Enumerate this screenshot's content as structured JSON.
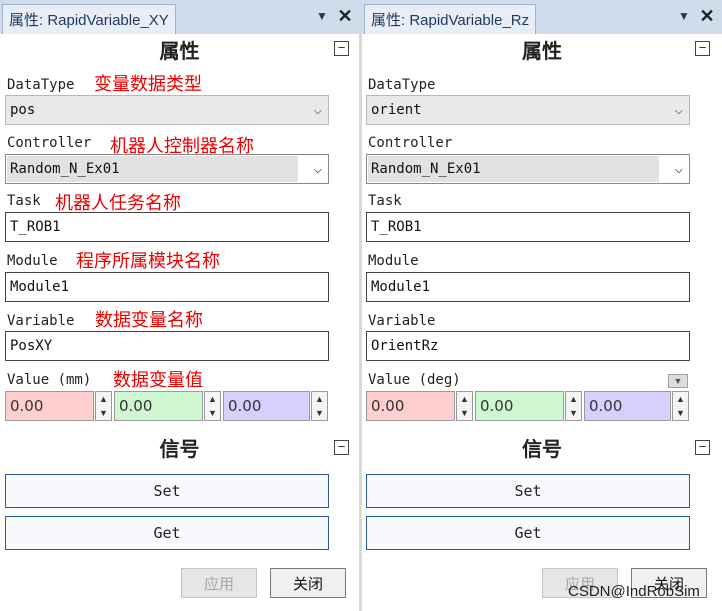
{
  "panels": [
    {
      "title": "属性: RapidVariable_XY",
      "properties_heading": "属性",
      "datatype": {
        "label": "DataType",
        "value": "pos",
        "note": "变量数据类型"
      },
      "controller": {
        "label": "Controller",
        "value": "Random_N_Ex01",
        "note": "机器人控制器名称"
      },
      "task": {
        "label": "Task",
        "value": "T_ROB1",
        "note": "机器人任务名称"
      },
      "module": {
        "label": "Module",
        "value": "Module1",
        "note": "程序所属模块名称"
      },
      "variable": {
        "label": "Variable",
        "value": "PosXY",
        "note": "数据变量名称"
      },
      "value": {
        "label": "Value (mm)",
        "note": "数据变量值",
        "x": "0.00",
        "y": "0.00",
        "z": "0.00"
      },
      "signals_heading": "信号",
      "set_label": "Set",
      "get_label": "Get",
      "apply_label": "应用",
      "close_label": "关闭"
    },
    {
      "title": "属性: RapidVariable_Rz",
      "properties_heading": "属性",
      "datatype": {
        "label": "DataType",
        "value": "orient"
      },
      "controller": {
        "label": "Controller",
        "value": "Random_N_Ex01"
      },
      "task": {
        "label": "Task",
        "value": "T_ROB1"
      },
      "module": {
        "label": "Module",
        "value": "Module1"
      },
      "variable": {
        "label": "Variable",
        "value": "OrientRz"
      },
      "value": {
        "label": "Value (deg)",
        "x": "0.00",
        "y": "0.00",
        "z": "0.00"
      },
      "signals_heading": "信号",
      "set_label": "Set",
      "get_label": "Get",
      "apply_label": "应用",
      "close_label": "关闭"
    }
  ],
  "icons": {
    "dropdown": "▼",
    "close": "✕",
    "collapse": "−",
    "spin_up": "▲",
    "spin_down": "▼"
  },
  "watermark": "CSDN@IndRobSim",
  "colors": {
    "field_x": "#ffcfcf",
    "field_y": "#cff7cf",
    "field_z": "#d6d0ff",
    "note": "#ee0000",
    "button_border": "#2e5c99"
  }
}
